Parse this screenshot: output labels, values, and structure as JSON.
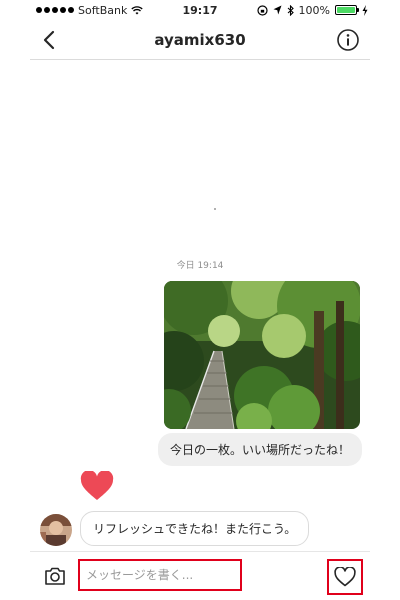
{
  "status_bar": {
    "carrier": "SoftBank",
    "time": "19:17",
    "battery": "100%",
    "battery_level": 1.0
  },
  "header": {
    "title": "ayamix630",
    "back_icon": "chevron-left-icon",
    "info_icon": "info-icon"
  },
  "thread": {
    "timestamp": "今日 19:14",
    "messages": [
      {
        "from": "me",
        "type": "photo",
        "subject": "forest stairway"
      },
      {
        "from": "me",
        "type": "text",
        "text": "今日の一枚。いい場所だったね！"
      },
      {
        "from": "them",
        "type": "reaction",
        "icon": "heart-icon"
      },
      {
        "from": "them",
        "type": "text",
        "text": "リフレッシュできたね！また行こう。"
      }
    ]
  },
  "composer": {
    "placeholder": "メッセージを書く...",
    "camera_icon": "camera-icon",
    "like_icon": "heart-outline-icon"
  },
  "colors": {
    "highlight": "#e0001b",
    "heart": "#ed4956",
    "battery": "#4cd964",
    "bubble": "#efefef"
  }
}
